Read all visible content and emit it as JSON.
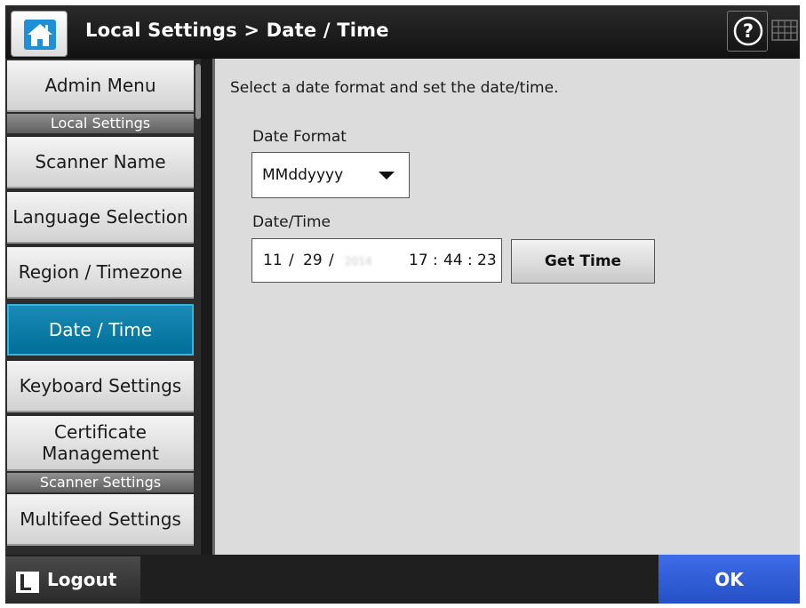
{
  "header": {
    "title": "Local Settings > Date / Time",
    "icons": {
      "home": "home-icon",
      "help": "help-icon",
      "keyboard": "keyboard-icon"
    }
  },
  "sidebar": {
    "items": [
      {
        "label": "Admin Menu",
        "active": false
      },
      {
        "section": "Local Settings"
      },
      {
        "label": "Scanner Name",
        "active": false
      },
      {
        "label": "Language Selection",
        "active": false
      },
      {
        "label": "Region / Timezone",
        "active": false
      },
      {
        "label": "Date / Time",
        "active": true
      },
      {
        "label": "Keyboard Settings",
        "active": false
      },
      {
        "label": "Certificate Management",
        "active": false
      },
      {
        "section": "Scanner Settings"
      },
      {
        "label": "Multifeed Settings",
        "active": false
      }
    ]
  },
  "main": {
    "instruction": "Select a date format and set the date/time.",
    "date_format": {
      "label": "Date Format",
      "value": "MMddyyyy"
    },
    "date_time": {
      "label": "Date/Time",
      "month": "11",
      "day": "29",
      "year": "2014",
      "hour": "17",
      "minute": "44",
      "second": "23",
      "separator_date": "/",
      "separator_time": ":"
    },
    "get_time_label": "Get Time"
  },
  "footer": {
    "logout_label": "Logout",
    "ok_label": "OK"
  },
  "colors": {
    "accent_active": "#0d7fab",
    "ok_button": "#2f5ddc",
    "content_bg": "#dcdcdc"
  }
}
